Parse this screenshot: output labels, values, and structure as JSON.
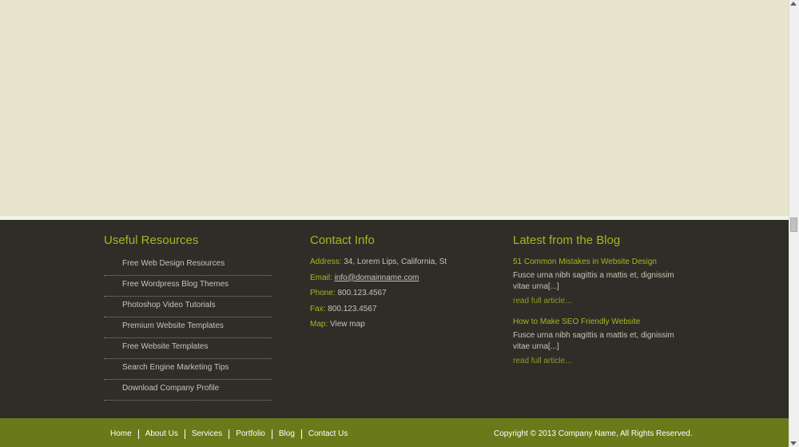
{
  "resources": {
    "title": "Useful Resources",
    "items": [
      "Free Web Design Resources",
      "Free Wordpress Blog Themes",
      "Photoshop Video Tutorials",
      "Premium Website Templates",
      "Free Website Templates",
      "Search Engine Marketing Tips",
      "Download Company Profile"
    ]
  },
  "contact": {
    "title": "Contact Info",
    "address_label": "Address:",
    "address_value": "34, Lorem Lips, California, St",
    "email_label": "Email:",
    "email_value": "info@domainname.com",
    "phone_label": "Phone:",
    "phone_value": "800.123.4567",
    "fax_label": "Fax:",
    "fax_value": "800.123.4567",
    "map_label": "Map:",
    "map_value": "View map"
  },
  "blog": {
    "title": "Latest from the Blog",
    "posts": [
      {
        "title": "51 Common Mistakes in Website Design",
        "excerpt": "Fusce urna nibh sagittis a mattis et, dignissim vitae urna[...]",
        "read_more": "read full article..."
      },
      {
        "title": "How to Make SEO Friendly Website",
        "excerpt": "Fusce urna nibh sagittis a mattis et, dignissim vitae urna[...]",
        "read_more": "read full article..."
      }
    ]
  },
  "nav": [
    "Home",
    "About Us",
    "Services",
    "Portfolio",
    "Blog",
    "Contact Us"
  ],
  "copyright": "Copyright © 2013 Company Name, All Rights Reserved.",
  "colors": {
    "page_bg": "#e6e5cb",
    "footer_bg": "#2f2d27",
    "accent": "#a4b820",
    "bottom_bar": "#6a7a1a",
    "text_light": "#c7c5b4"
  }
}
